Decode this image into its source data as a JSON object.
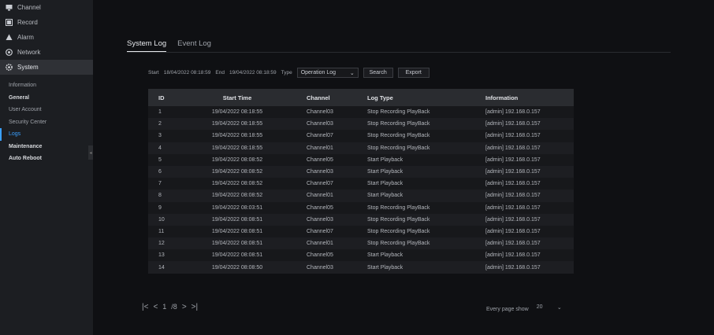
{
  "sidebar": {
    "items": [
      {
        "label": "Channel",
        "icon": "monitor-icon"
      },
      {
        "label": "Record",
        "icon": "record-icon"
      },
      {
        "label": "Alarm",
        "icon": "alarm-icon"
      },
      {
        "label": "Network",
        "icon": "network-icon"
      },
      {
        "label": "System",
        "icon": "gear-icon"
      }
    ],
    "sub_items": [
      "Information",
      "General",
      "User Account",
      "Security Center",
      "Logs",
      "Maintenance",
      "Auto Reboot"
    ]
  },
  "tabs": [
    "System Log",
    "Event Log"
  ],
  "filter": {
    "start_label": "Start",
    "start_value": "18/04/2022 08:18:59",
    "end_label": "End",
    "end_value": "19/04/2022 08:18:59",
    "type_label": "Type",
    "type_value": "Operation Log",
    "search_label": "Search",
    "export_label": "Export"
  },
  "table": {
    "columns": [
      "ID",
      "Start Time",
      "Channel",
      "Log Type",
      "Information"
    ],
    "rows": [
      [
        "1",
        "19/04/2022 08:18:55",
        "Channel03",
        "Stop Recording PlayBack",
        "[admin] 192.168.0.157"
      ],
      [
        "2",
        "19/04/2022 08:18:55",
        "Channel03",
        "Stop Recording PlayBack",
        "[admin] 192.168.0.157"
      ],
      [
        "3",
        "19/04/2022 08:18:55",
        "Channel07",
        "Stop Recording PlayBack",
        "[admin] 192.168.0.157"
      ],
      [
        "4",
        "19/04/2022 08:18:55",
        "Channel01",
        "Stop Recording PlayBack",
        "[admin] 192.168.0.157"
      ],
      [
        "5",
        "19/04/2022 08:08:52",
        "Channel05",
        "Start Playback",
        "[admin] 192.168.0.157"
      ],
      [
        "6",
        "19/04/2022 08:08:52",
        "Channel03",
        "Start Playback",
        "[admin] 192.168.0.157"
      ],
      [
        "7",
        "19/04/2022 08:08:52",
        "Channel07",
        "Start Playback",
        "[admin] 192.168.0.157"
      ],
      [
        "8",
        "19/04/2022 08:08:52",
        "Channel01",
        "Start Playback",
        "[admin] 192.168.0.157"
      ],
      [
        "9",
        "19/04/2022 08:03:51",
        "Channel05",
        "Stop Recording PlayBack",
        "[admin] 192.168.0.157"
      ],
      [
        "10",
        "19/04/2022 08:08:51",
        "Channel03",
        "Stop Recording PlayBack",
        "[admin] 192.168.0.157"
      ],
      [
        "11",
        "19/04/2022 08:08:51",
        "Channel07",
        "Stop Recording PlayBack",
        "[admin] 192.168.0.157"
      ],
      [
        "12",
        "19/04/2022 08:08:51",
        "Channel01",
        "Stop Recording PlayBack",
        "[admin] 192.168.0.157"
      ],
      [
        "13",
        "19/04/2022 08:08:51",
        "Channel05",
        "Start Playback",
        "[admin] 192.168.0.157"
      ],
      [
        "14",
        "19/04/2022 08:08:50",
        "Channel03",
        "Start Playback",
        "[admin] 192.168.0.157"
      ]
    ]
  },
  "pager": {
    "first": "|<",
    "prev": "<",
    "current": "1",
    "total": "/8",
    "next": ">",
    "last": ">|"
  },
  "page_size": {
    "label": "Every page show",
    "value": "20"
  },
  "colors": {
    "accent": "#3aa0ff",
    "background": "#0f1013",
    "sidebar": "#1c1e22"
  }
}
